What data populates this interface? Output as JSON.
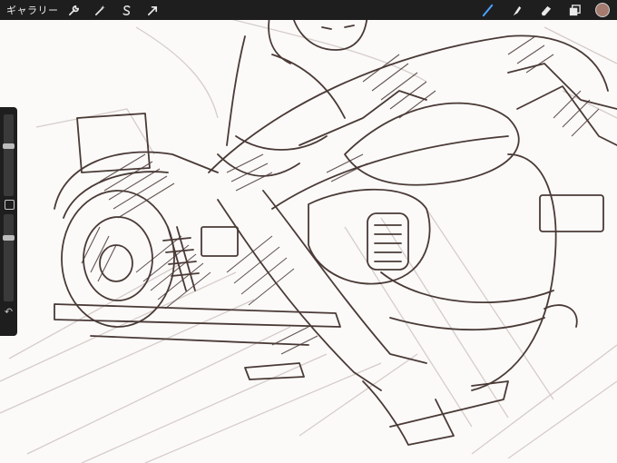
{
  "topbar": {
    "gallery_label": "ギャラリー",
    "left_tools": [
      {
        "name": "actions-wrench-icon"
      },
      {
        "name": "adjustments-wand-icon"
      },
      {
        "name": "selection-s-icon"
      },
      {
        "name": "transform-arrow-icon"
      }
    ],
    "right_tools": [
      {
        "name": "brush-icon"
      },
      {
        "name": "smudge-icon"
      },
      {
        "name": "eraser-icon"
      },
      {
        "name": "layers-icon"
      }
    ],
    "current_color": "#a47b6e"
  },
  "sidebar": {
    "brush_size_level": 0.62,
    "opacity_level": 0.75
  }
}
